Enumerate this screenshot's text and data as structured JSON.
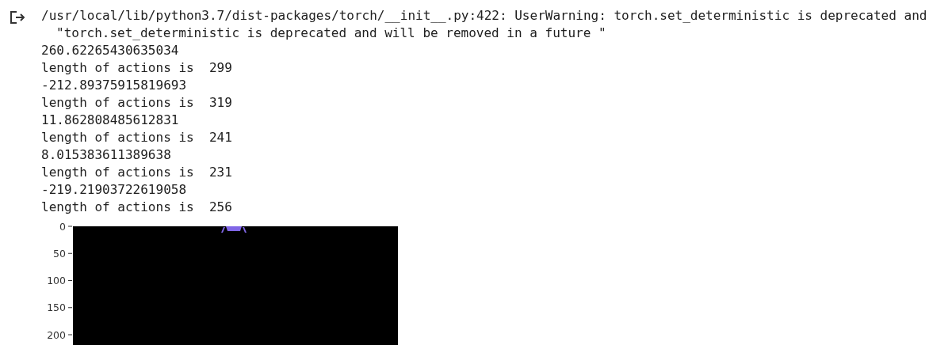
{
  "output_lines": [
    {
      "text": "/usr/local/lib/python3.7/dist-packages/torch/__init__.py:422: UserWarning: torch.set_deterministic is deprecated and",
      "indented": false
    },
    {
      "text": "\"torch.set_deterministic is deprecated and will be removed in a future \"",
      "indented": true
    },
    {
      "text": "260.62265430635034",
      "indented": false
    },
    {
      "text": "length of actions is  299",
      "indented": false
    },
    {
      "text": "-212.89375915819693",
      "indented": false
    },
    {
      "text": "length of actions is  319",
      "indented": false
    },
    {
      "text": "11.862808485612831",
      "indented": false
    },
    {
      "text": "length of actions is  241",
      "indented": false
    },
    {
      "text": "8.015383611389638",
      "indented": false
    },
    {
      "text": "length of actions is  231",
      "indented": false
    },
    {
      "text": "-219.21903722619058",
      "indented": false
    },
    {
      "text": "length of actions is  256",
      "indented": false
    }
  ],
  "image_plot": {
    "kind": "picture",
    "y_ticks": [
      "0",
      "50",
      "100",
      "150",
      "200"
    ]
  }
}
